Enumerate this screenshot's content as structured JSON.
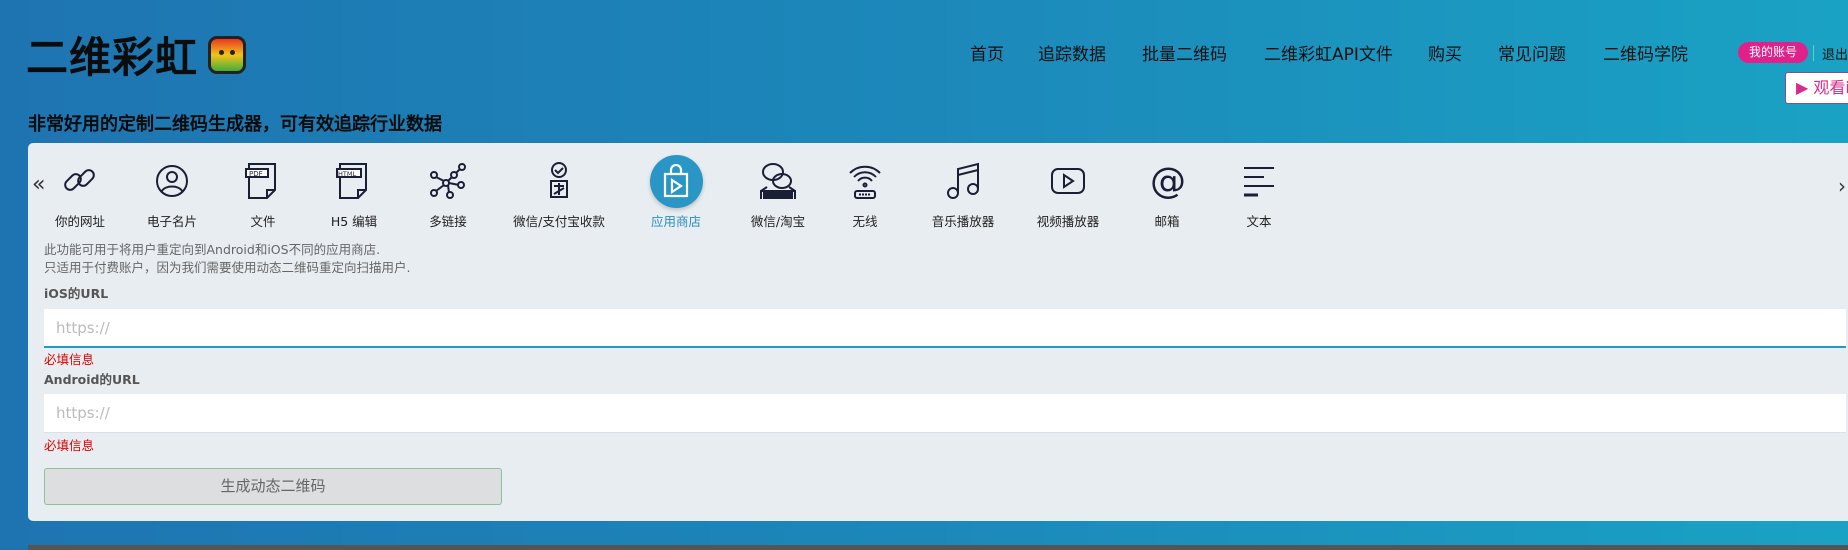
{
  "header": {
    "logo_text": "二维彩虹",
    "nav": [
      "首页",
      "追踪数据",
      "批量二维码",
      "二维彩虹API文件",
      "购买",
      "常见问题",
      "二维码学院"
    ],
    "account_label": "我的账号",
    "logout_label": "退出",
    "watch_label": "▶ 观看i"
  },
  "subtitle": "非常好用的定制二维码生成器，可有效追踪行业数据",
  "types": [
    {
      "label": "你的网址",
      "icon": "link-icon"
    },
    {
      "label": "电子名片",
      "icon": "user-circle-icon"
    },
    {
      "label": "文件",
      "icon": "pdf-file-icon"
    },
    {
      "label": "H5 编辑",
      "icon": "html-file-icon"
    },
    {
      "label": "多链接",
      "icon": "multi-link-icon"
    },
    {
      "label": "微信/支付宝收款",
      "icon": "payment-icon"
    },
    {
      "label": "应用商店",
      "icon": "app-store-icon",
      "active": true
    },
    {
      "label": "微信/淘宝",
      "icon": "wechat-taobao-icon"
    },
    {
      "label": "无线",
      "icon": "wifi-icon"
    },
    {
      "label": "音乐播放器",
      "icon": "music-icon"
    },
    {
      "label": "视频播放器",
      "icon": "video-icon"
    },
    {
      "label": "邮箱",
      "icon": "at-icon"
    },
    {
      "label": "文本",
      "icon": "text-icon"
    }
  ],
  "form": {
    "desc1": "此功能可用于将用户重定向到Android和iOS不同的应用商店.",
    "desc2": "只适用于付费账户，因为我们需要使用动态二维码重定向扫描用户.",
    "ios_label": "iOS的URL",
    "ios_placeholder": "https://",
    "ios_error": "必填信息",
    "android_label": "Android的URL",
    "android_placeholder": "https://",
    "android_error": "必填信息",
    "submit_label": "生成动态二维码"
  },
  "colors": {
    "accent": "#2a96c5",
    "account": "#e2208a",
    "error": "#dd0000"
  }
}
